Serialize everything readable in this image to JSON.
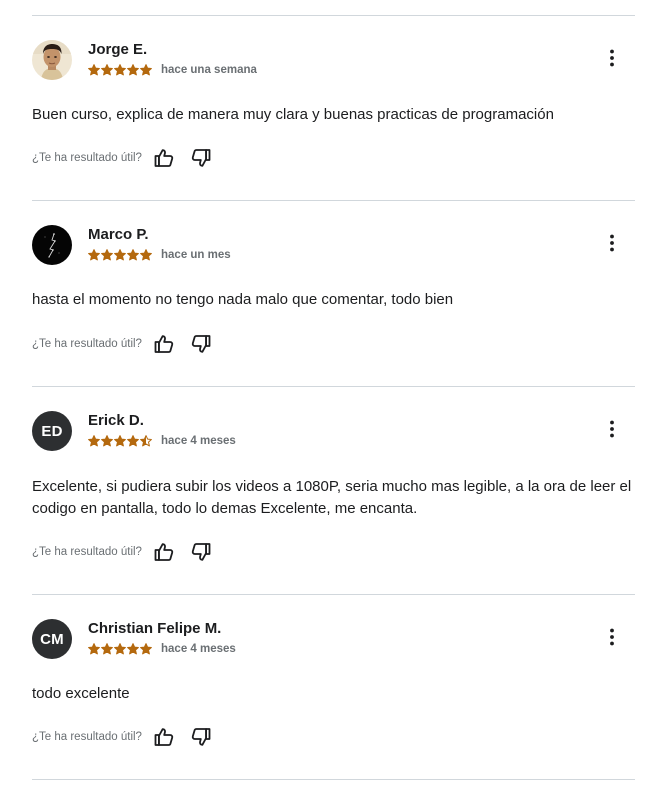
{
  "helpful_label": "¿Te ha resultado útil?",
  "colors": {
    "star": "#b4690e",
    "star_empty": "#ffffff",
    "divider": "#d1d7dc",
    "avatar_bg": "#2d2f31",
    "muted_text": "#6a6f73",
    "text": "#1c1d1f"
  },
  "reviews": [
    {
      "name": "Jorge E.",
      "rating": 5,
      "date": "hace una semana",
      "text": "Buen curso, explica de manera muy clara y buenas practicas de programación",
      "avatar": {
        "type": "photo",
        "icon": "portrait-photo"
      }
    },
    {
      "name": "Marco P.",
      "rating": 5,
      "date": "hace un mes",
      "text": "hasta el momento no tengo nada malo que comentar, todo bien",
      "avatar": {
        "type": "photo",
        "icon": "dark-photo"
      }
    },
    {
      "name": "Erick D.",
      "rating": 4.5,
      "date": "hace 4 meses",
      "text": "Excelente, si pudiera subir los videos a 1080P, seria mucho mas legible, a la ora de leer el codigo en pantalla, todo lo demas Excelente, me encanta.",
      "avatar": {
        "type": "initials",
        "initials": "ED"
      }
    },
    {
      "name": "Christian Felipe M.",
      "rating": 5,
      "date": "hace 4 meses",
      "text": "todo excelente",
      "avatar": {
        "type": "initials",
        "initials": "CM"
      }
    }
  ]
}
